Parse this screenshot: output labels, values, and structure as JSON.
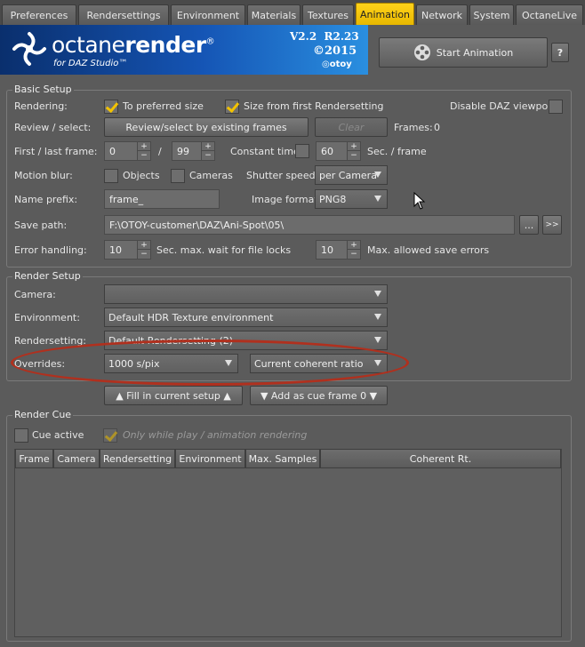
{
  "tabs": [
    {
      "label": "Preferences",
      "active": false
    },
    {
      "label": "Rendersettings",
      "active": false
    },
    {
      "label": "Environment",
      "active": false
    },
    {
      "label": "Materials",
      "active": false
    },
    {
      "label": "Textures",
      "active": false
    },
    {
      "label": "Animation",
      "active": true
    },
    {
      "label": "Network",
      "active": false
    },
    {
      "label": "System",
      "active": false
    },
    {
      "label": "OctaneLive",
      "active": false
    }
  ],
  "banner": {
    "brand_a": "octane",
    "brand_b": "render",
    "brand_mark": "®",
    "subtitle": "for DAZ Studio™",
    "version_a": "V2.2",
    "version_b": "R2.23",
    "year": "©2015",
    "vendor": "otoy"
  },
  "start_animation": "Start Animation",
  "help": "?",
  "basic": {
    "title": "Basic Setup",
    "rendering_label": "Rendering:",
    "to_preferred_size": "To preferred size",
    "size_from_first": "Size from first Rendersetting",
    "disable_daz_viewport": "Disable DAZ viewport",
    "review_label": "Review / select:",
    "review_button": "Review/select by existing frames",
    "clear_button": "Clear",
    "frames_label": "Frames:",
    "frames_value": "0",
    "first_last_label": "First / last frame:",
    "first_frame": "0",
    "slash": "/",
    "last_frame": "99",
    "constant_time": "Constant time:",
    "sec_value": "60",
    "sec_per_frame": "Sec. / frame",
    "motion_blur_label": "Motion blur:",
    "objects": "Objects",
    "cameras": "Cameras",
    "shutter_speed_label": "Shutter speed:",
    "shutter_speed_value": "per Camera",
    "name_prefix_label": "Name prefix:",
    "name_prefix_value": "frame_",
    "image_format_label": "Image format:",
    "image_format_value": "PNG8",
    "save_path_label": "Save path:",
    "save_path_value": "F:\\OTOY-customer\\DAZ\\Ani-Spot\\05\\",
    "browse": "...",
    "open": ">>",
    "error_label": "Error handling:",
    "wait_value": "10",
    "wait_text": "Sec. max. wait for file locks",
    "errors_value": "10",
    "errors_text": "Max. allowed save errors"
  },
  "render": {
    "title": "Render Setup",
    "camera_label": "Camera:",
    "camera_value": "",
    "environment_label": "Environment:",
    "environment_value": "Default HDR Texture environment",
    "rendersetting_label": "Rendersetting:",
    "rendersetting_value": "Default Rendersetting (2)",
    "overrides_label": "Overrides:",
    "samples_value": "1000 s/pix",
    "ratio_value": "Current coherent ratio"
  },
  "fill_button": "▲ Fill in current setup ▲",
  "add_button": "▼ Add as cue frame 0 ▼",
  "cue": {
    "title": "Render Cue",
    "cue_active": "Cue active",
    "only_while_play": "Only while play / animation rendering",
    "columns": [
      "Frame",
      "Camera",
      "Rendersetting",
      "Environment",
      "Max. Samples",
      "Coherent Rt."
    ]
  },
  "colors": {
    "accent": "#f2c200",
    "highlight_ellipse": "#b0301e",
    "panel": "#5b5b5b"
  }
}
